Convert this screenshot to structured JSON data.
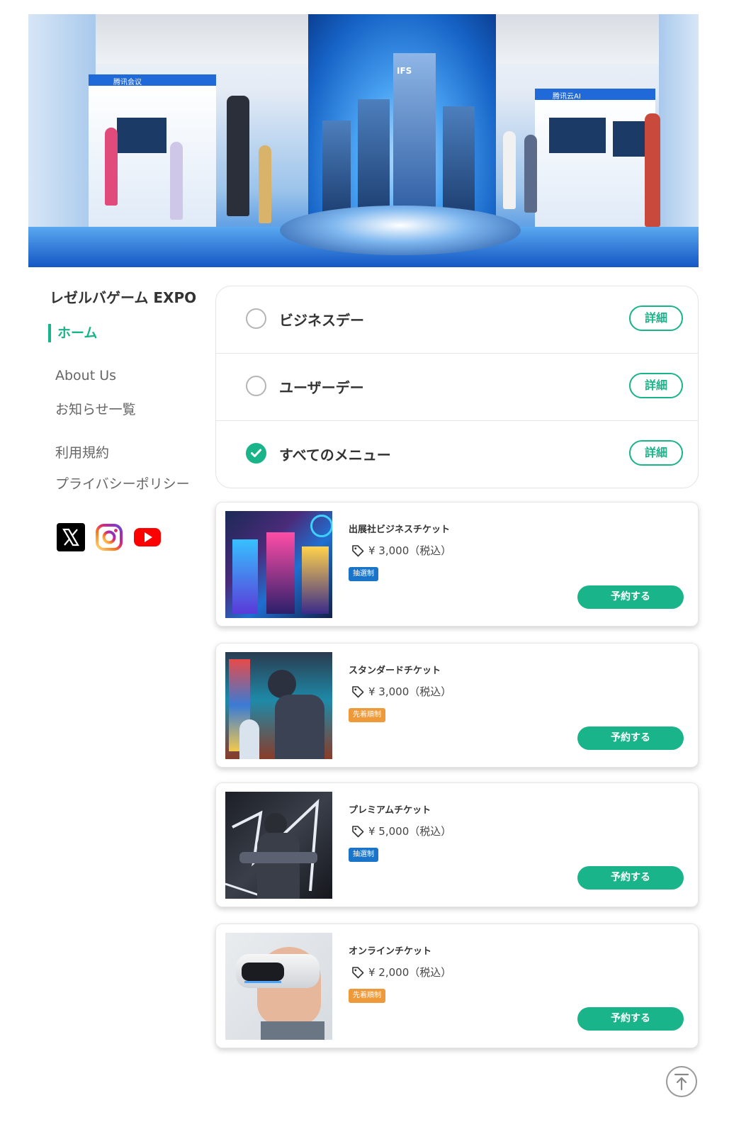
{
  "site": {
    "title": "レゼルバゲーム EXPO"
  },
  "hero": {
    "image": "expo-exhibition-hall-photo",
    "visible_text": [
      "腾讯会议",
      "IFS",
      "腾讯云AI"
    ]
  },
  "sidebar": {
    "nav": [
      {
        "label": "ホーム",
        "active": true
      },
      {
        "label": "About Us"
      },
      {
        "label": "お知らせ一覧"
      },
      {
        "label": "利用規約"
      },
      {
        "label": "プライバシーポリシー"
      }
    ],
    "social_icons": [
      "x-icon",
      "instagram-icon",
      "youtube-icon"
    ]
  },
  "filters": [
    {
      "label": "ビジネスデー",
      "checked": false,
      "detail": "詳細"
    },
    {
      "label": "ユーザーデー",
      "checked": false,
      "detail": "詳細"
    },
    {
      "label": "すべてのメニュー",
      "checked": true,
      "detail": "詳細"
    }
  ],
  "tickets": [
    {
      "name": "出展社ビジネスチケット",
      "price": "¥ 3,000（税込）",
      "badge": "抽選制",
      "badge_color": "#1a74c9",
      "button": "予約する",
      "image": "arcade-machines-photo"
    },
    {
      "name": "スタンダードチケット",
      "price": "¥ 3,000（税込）",
      "badge": "先着順制",
      "badge_color": "#ee9a3a",
      "button": "予約する",
      "image": "people-playing-arcade-photo"
    },
    {
      "name": "プレミアムチケット",
      "price": "¥ 5,000（税込）",
      "badge": "抽選制",
      "badge_color": "#1a74c9",
      "button": "予約する",
      "image": "vr-shooter-photo"
    },
    {
      "name": "オンラインチケット",
      "price": "¥ 2,000（税込）",
      "badge": "先着順制",
      "badge_color": "#ee9a3a",
      "button": "予約する",
      "image": "child-vr-headset-photo"
    }
  ],
  "colors": {
    "accent": "#19b48a",
    "lottery": "#1a74c9",
    "first_come": "#ee9a3a"
  },
  "icons": {
    "price": "tag-icon",
    "back_to_top": "arrow-up-icon"
  }
}
